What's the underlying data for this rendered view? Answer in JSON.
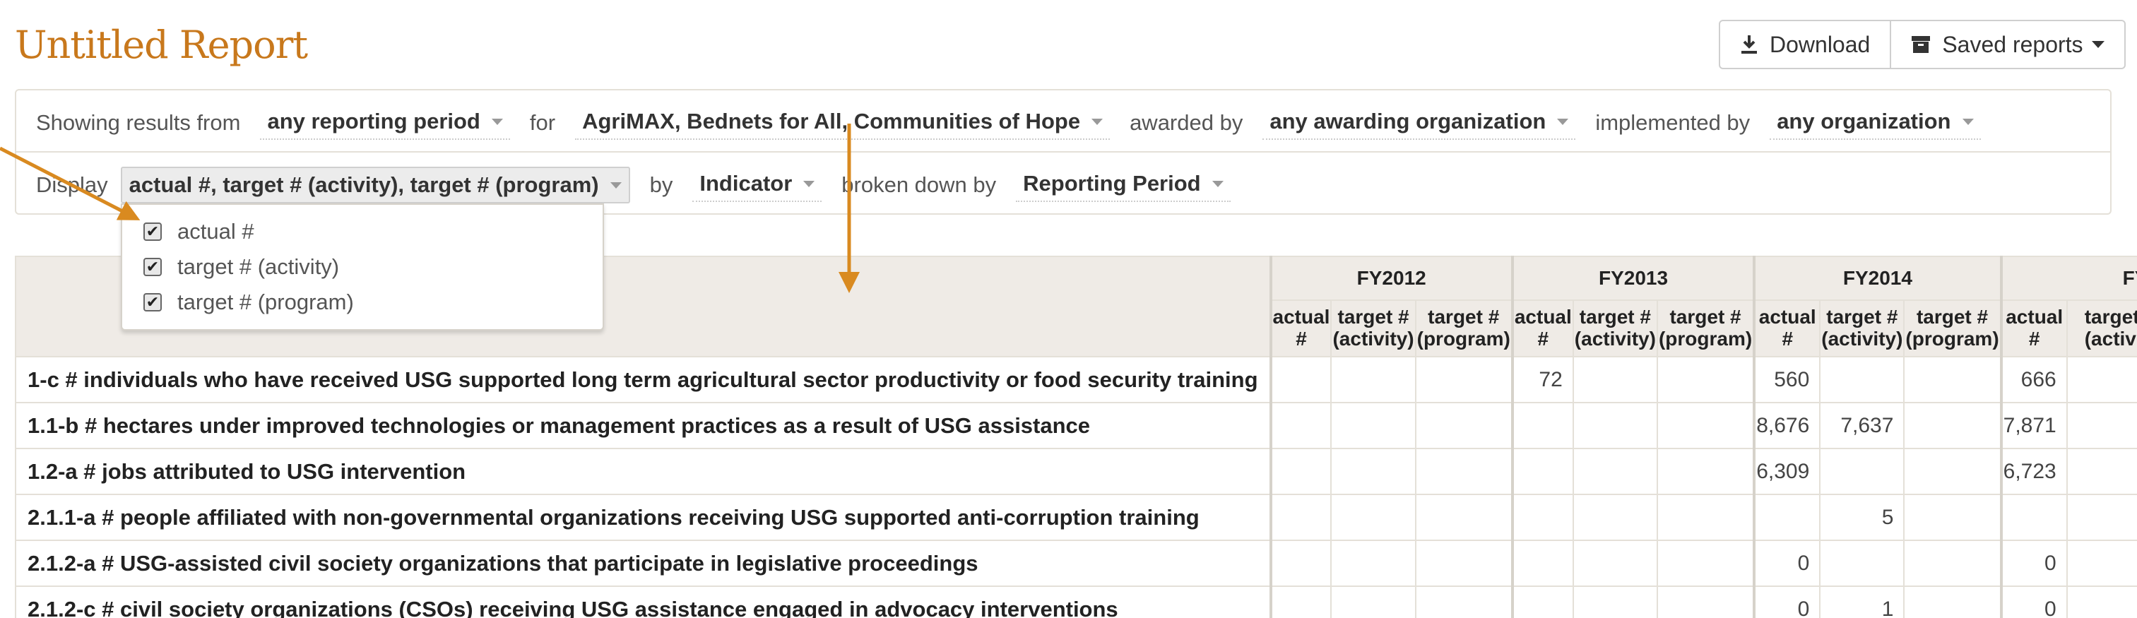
{
  "page": {
    "title": "Untitled Report"
  },
  "toolbar": {
    "download_label": "Download",
    "saved_reports_label": "Saved reports"
  },
  "filters": {
    "row1": {
      "showing_label": "Showing results from",
      "period_value": "any reporting period",
      "for_label": "for",
      "activities_value": "AgriMAX, Bednets for All, Communities of Hope",
      "awarded_label": "awarded by",
      "awarding_value": "any awarding organization",
      "implemented_label": "implemented by",
      "implementing_value": "any organization"
    },
    "row2": {
      "display_label": "Display",
      "display_value": "actual #, target # (activity), target # (program)",
      "by_label": "by",
      "by_value": "Indicator",
      "breakdown_label": "broken down by",
      "breakdown_value": "Reporting Period"
    }
  },
  "display_dropdown": {
    "options": [
      {
        "label": "actual #",
        "checked": true
      },
      {
        "label": "target # (activity)",
        "checked": true
      },
      {
        "label": "target # (program)",
        "checked": true
      }
    ]
  },
  "table": {
    "years": [
      "FY2012",
      "FY2013",
      "FY2014",
      "FY"
    ],
    "subcolumns": [
      "actual #",
      "target #\n(activity)",
      "target #\n(program)"
    ],
    "rows": [
      {
        "label": "1-c # individuals who have received USG supported long term agricultural sector productivity or food security training",
        "values": [
          "",
          "",
          "",
          "72",
          "",
          "",
          "560",
          "",
          "",
          "666",
          ""
        ]
      },
      {
        "label": "1.1-b # hectares under improved technologies or management practices as a result of USG assistance",
        "values": [
          "",
          "",
          "",
          "",
          "",
          "",
          "8,676",
          "7,637",
          "",
          "7,871",
          ""
        ]
      },
      {
        "label": "1.2-a # jobs attributed to USG intervention",
        "values": [
          "",
          "",
          "",
          "",
          "",
          "",
          "6,309",
          "",
          "",
          "6,723",
          ""
        ]
      },
      {
        "label": "2.1.1-a # people affiliated with non-governmental organizations receiving USG supported anti-corruption training",
        "values": [
          "",
          "",
          "",
          "",
          "",
          "",
          "",
          "5",
          "",
          "",
          ""
        ]
      },
      {
        "label": "2.1.2-a # USG-assisted civil society organizations that participate in legislative proceedings",
        "values": [
          "",
          "",
          "",
          "",
          "",
          "",
          "0",
          "",
          "",
          "0",
          ""
        ]
      },
      {
        "label": "2.1.2-c # civil society organizations (CSOs) receiving USG assistance engaged in advocacy interventions",
        "values": [
          "",
          "",
          "",
          "",
          "",
          "",
          "0",
          "1",
          "",
          "0",
          ""
        ]
      }
    ]
  },
  "colors": {
    "accent": "#c8781c",
    "header_bg": "#efebe6",
    "border": "#e4e0d8"
  },
  "icons": {
    "download": "download-icon",
    "saved": "archive-box-icon"
  }
}
